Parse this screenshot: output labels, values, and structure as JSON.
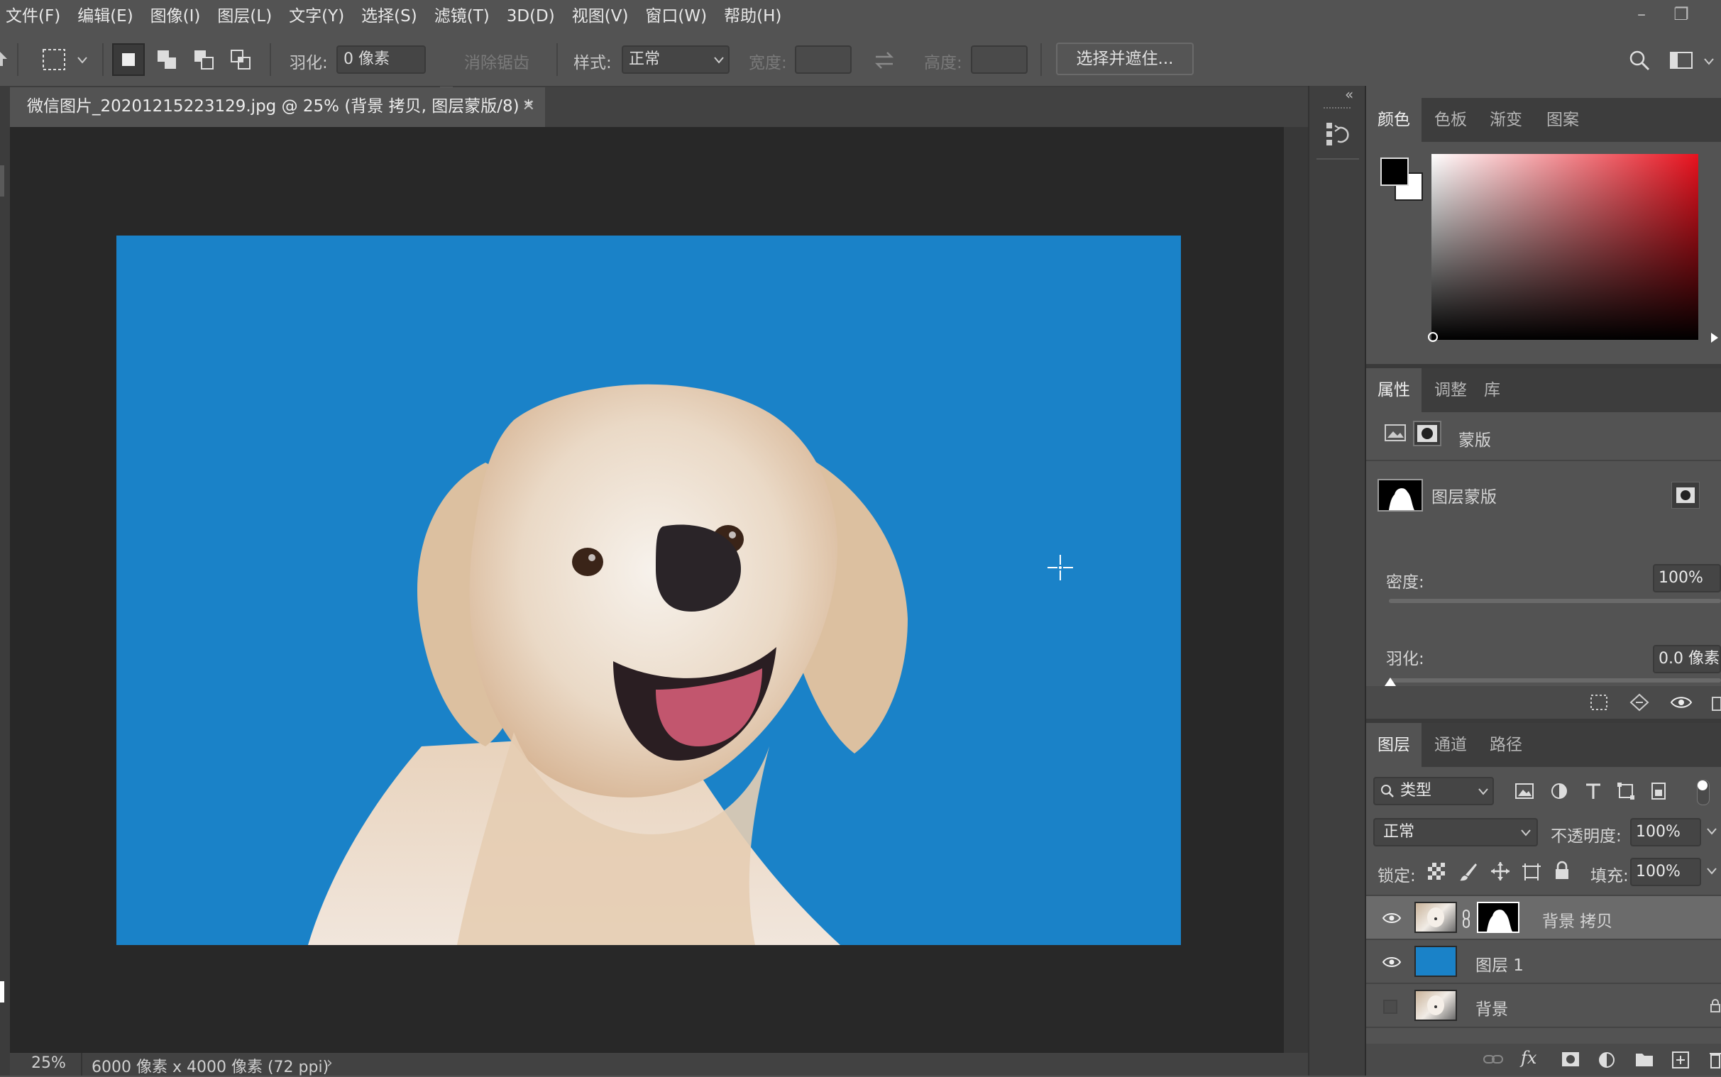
{
  "menu": [
    "文件(F)",
    "编辑(E)",
    "图像(I)",
    "图层(L)",
    "文字(Y)",
    "选择(S)",
    "滤镜(T)",
    "3D(D)",
    "视图(V)",
    "窗口(W)",
    "帮助(H)"
  ],
  "options": {
    "feather_label": "羽化:",
    "feather_value": "0 像素",
    "antialias_label": "消除锯齿",
    "style_label": "样式:",
    "style_value": "正常",
    "width_label": "宽度:",
    "height_label": "高度:",
    "select_mask_button": "选择并遮住..."
  },
  "document": {
    "tab_title": "微信图片_20201215223129.jpg @ 25% (背景 拷贝, 图层蒙版/8) *",
    "zoom": "25%",
    "dimensions": "6000 像素 x 4000 像素 (72 ppi)",
    "canvas_color": "#1a82c8"
  },
  "color_panel": {
    "tabs": [
      "颜色",
      "色板",
      "渐变",
      "图案"
    ],
    "foreground": "#000000",
    "background": "#ffffff",
    "hue_color": "#e8121e"
  },
  "properties_panel": {
    "tabs": [
      "属性",
      "调整",
      "库"
    ],
    "section_label": "蒙版",
    "mask_label": "图层蒙版",
    "density_label": "密度:",
    "density_value": "100%",
    "feather_label": "羽化:",
    "feather_value": "0.0 像素"
  },
  "layers_panel": {
    "tabs": [
      "图层",
      "通道",
      "路径"
    ],
    "filter_value": "类型",
    "blend_mode": "正常",
    "opacity_label": "不透明度:",
    "opacity_value": "100%",
    "lock_label": "锁定:",
    "fill_label": "填充:",
    "fill_value": "100%",
    "layers": [
      {
        "name": "背景 拷贝",
        "visible": true
      },
      {
        "name": "图层 1",
        "visible": true
      },
      {
        "name": "背景",
        "visible": false
      }
    ]
  }
}
